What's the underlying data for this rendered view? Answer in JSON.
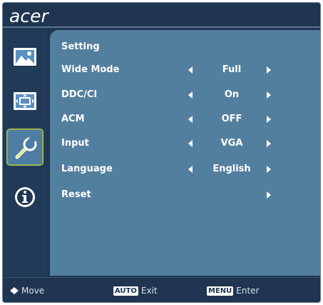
{
  "brand": {
    "logo_text": "acer"
  },
  "sidebar": {
    "items": [
      {
        "id": "picture",
        "icon": "picture-icon",
        "selected": false
      },
      {
        "id": "osd",
        "icon": "screen-position-icon",
        "selected": false
      },
      {
        "id": "setting",
        "icon": "wrench-setting-icon",
        "selected": true
      },
      {
        "id": "info",
        "icon": "info-icon",
        "selected": false
      }
    ]
  },
  "panel": {
    "title": "Setting",
    "rows": [
      {
        "label": "Wide Mode",
        "value": "Full",
        "has_left": true,
        "has_right": true
      },
      {
        "label": "DDC/CI",
        "value": "On",
        "has_left": true,
        "has_right": true
      },
      {
        "label": "ACM",
        "value": "OFF",
        "has_left": true,
        "has_right": true
      },
      {
        "label": "Input",
        "value": "VGA",
        "has_left": true,
        "has_right": true
      },
      {
        "label": "Language",
        "value": "English",
        "has_left": true,
        "has_right": true
      },
      {
        "label": "Reset",
        "value": "",
        "has_left": false,
        "has_right": true
      }
    ]
  },
  "footer": {
    "move_label": "Move",
    "auto_key": "AUTO",
    "auto_label": "Exit",
    "menu_key": "MENU",
    "menu_label": "Enter"
  },
  "colors": {
    "frame": "#1f3550",
    "panel": "#537f9f",
    "selected_item": "#4e7da4",
    "selected_border": "#b6c95a"
  }
}
